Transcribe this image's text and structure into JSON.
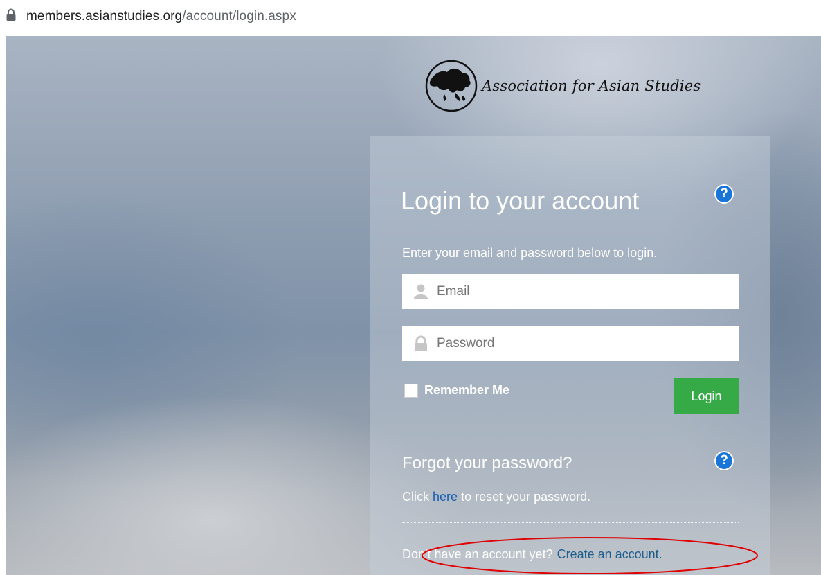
{
  "browser": {
    "url_domain": "members.asianstudies.org",
    "url_path": "/account/login.aspx"
  },
  "logo": {
    "text": "Association for Asian Studies"
  },
  "login": {
    "title": "Login to your account",
    "instructions": "Enter your email and password below to login.",
    "email_placeholder": "Email",
    "password_placeholder": "Password",
    "remember_label": "Remember Me",
    "login_button": "Login"
  },
  "forgot": {
    "title": "Forgot your password?",
    "click_text": "Click",
    "here_link": "here",
    "rest_text": "to reset your password."
  },
  "signup": {
    "prompt": "Don't have an account yet?",
    "link": "Create an account."
  },
  "colors": {
    "login_button": "#35aa47",
    "help_icon": "#1a75d8",
    "link": "#1f5e8c",
    "annotation": "#e00000"
  }
}
